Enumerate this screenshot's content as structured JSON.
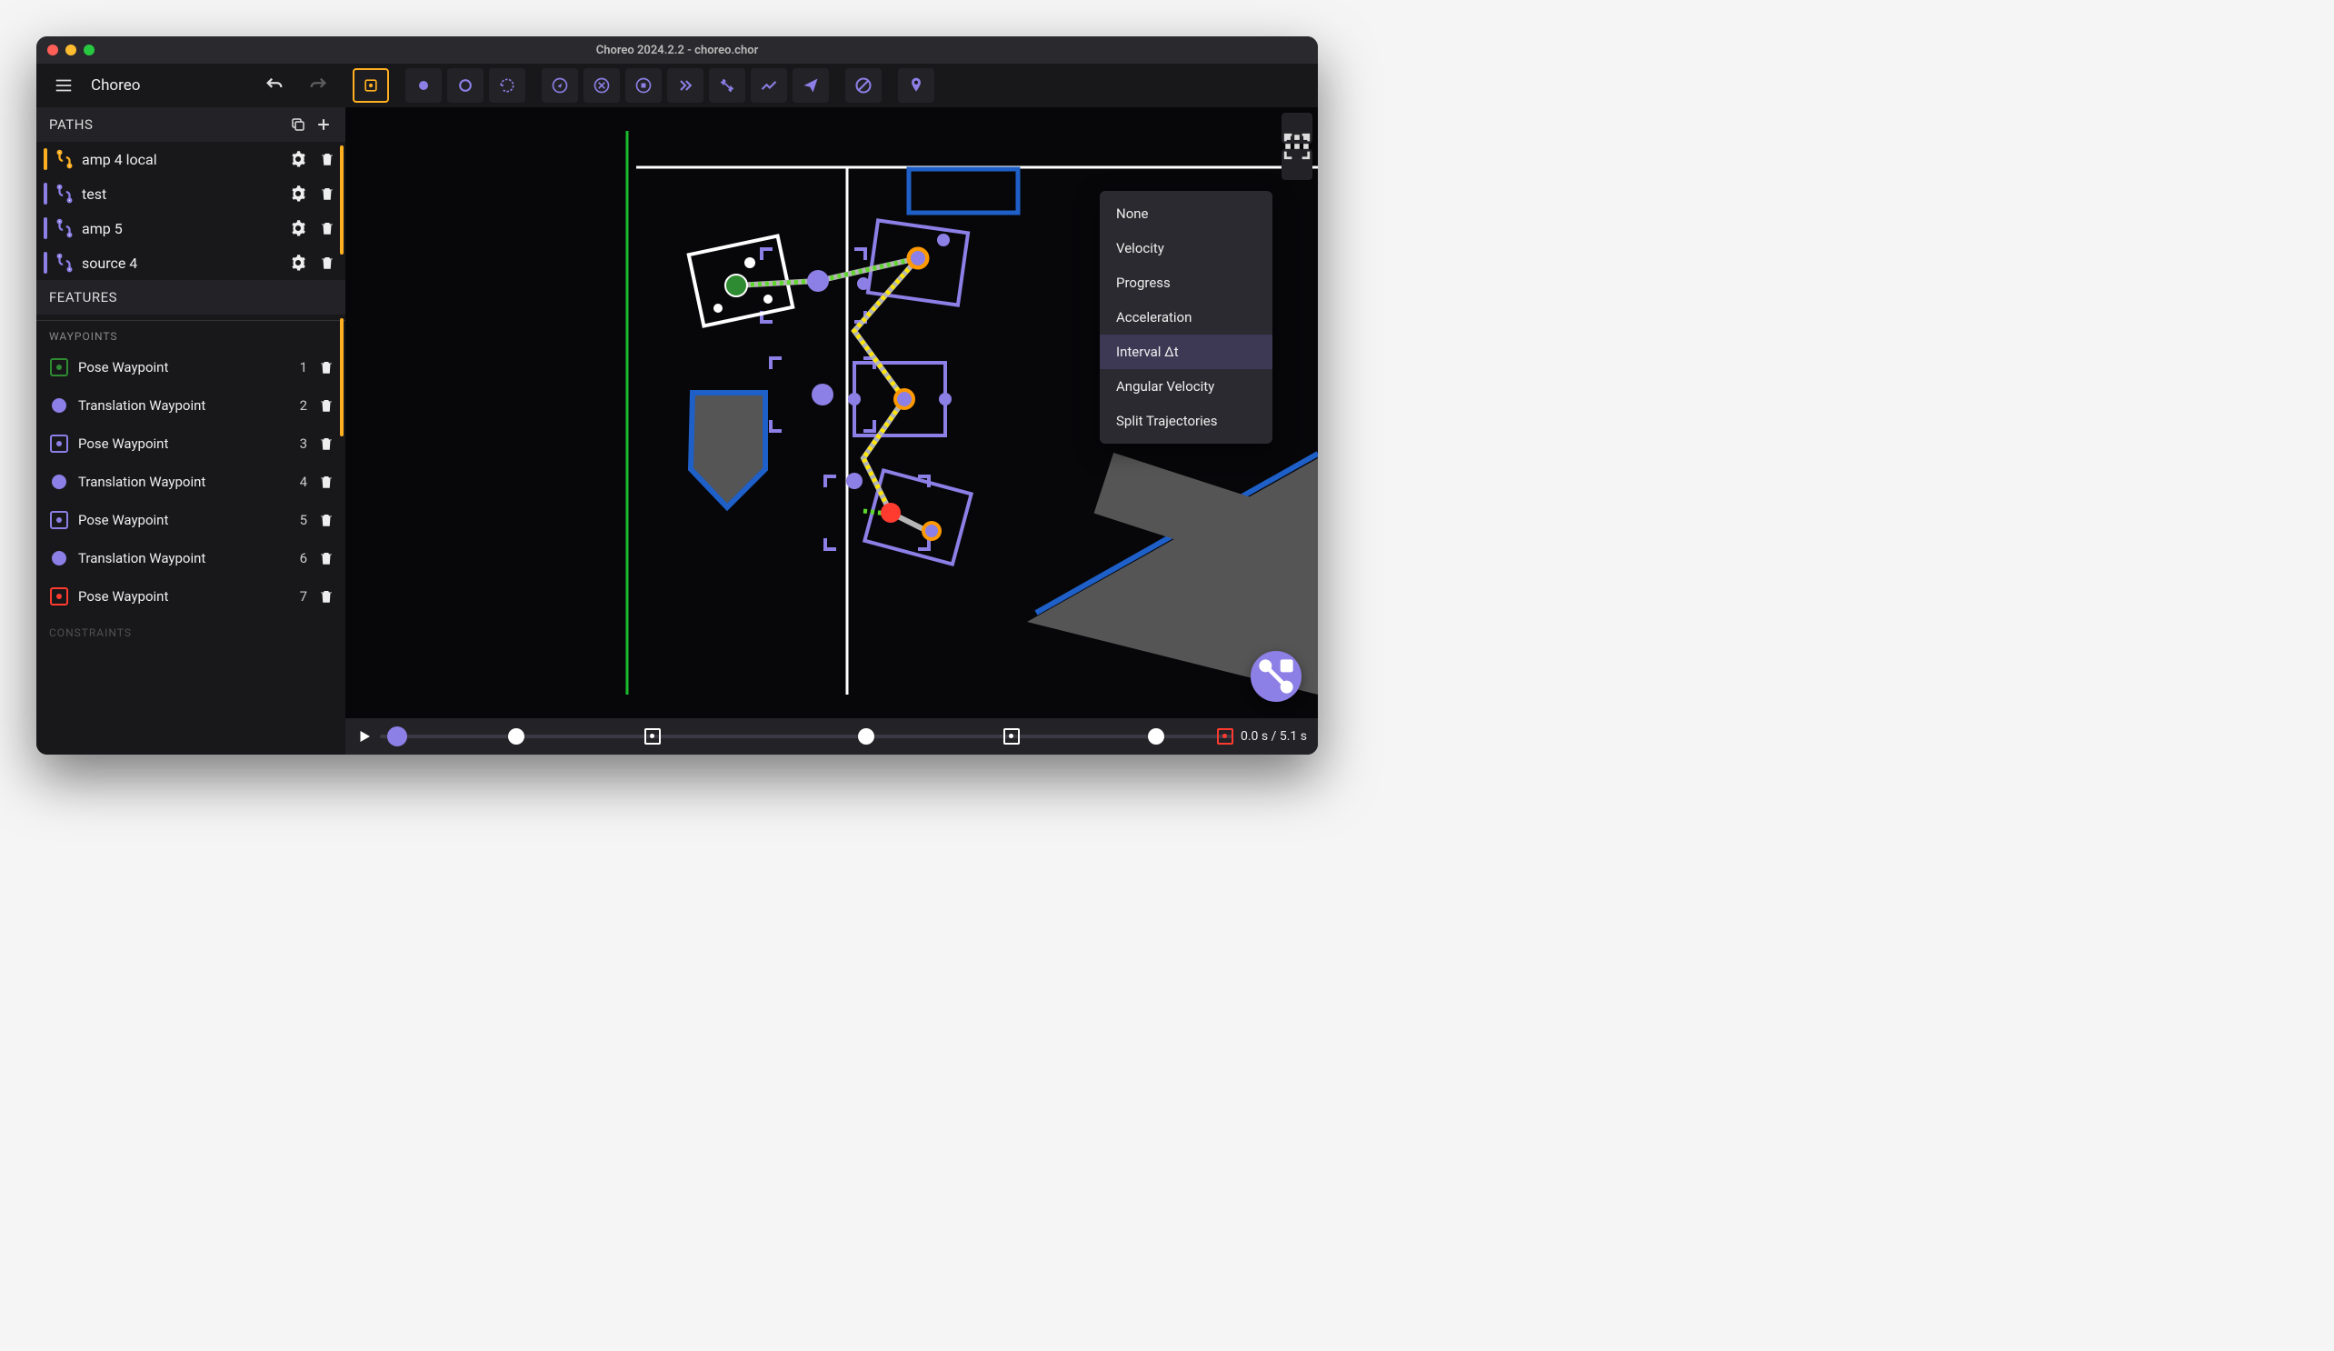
{
  "window": {
    "title": "Choreo 2024.2.2 - choreo.chor"
  },
  "app": {
    "name": "Choreo"
  },
  "sections": {
    "paths": "PATHS",
    "features": "FEATURES",
    "waypoints": "WAYPOINTS",
    "constraints": "CONSTRAINTS"
  },
  "paths": [
    {
      "name": "amp 4 local",
      "active": true
    },
    {
      "name": "test",
      "active": false
    },
    {
      "name": "amp 5",
      "active": false
    },
    {
      "name": "source 4",
      "active": false
    }
  ],
  "waypoints": [
    {
      "label": "Pose Waypoint",
      "index": "1",
      "type": "pose",
      "color": "#2e8b32"
    },
    {
      "label": "Translation Waypoint",
      "index": "2",
      "type": "trans"
    },
    {
      "label": "Pose Waypoint",
      "index": "3",
      "type": "pose",
      "color": "#8c7fe6"
    },
    {
      "label": "Translation Waypoint",
      "index": "4",
      "type": "trans"
    },
    {
      "label": "Pose Waypoint",
      "index": "5",
      "type": "pose",
      "color": "#8c7fe6"
    },
    {
      "label": "Translation Waypoint",
      "index": "6",
      "type": "trans"
    },
    {
      "label": "Pose Waypoint",
      "index": "7",
      "type": "pose",
      "color": "#ff3b30"
    }
  ],
  "popup": {
    "items": [
      "None",
      "Velocity",
      "Progress",
      "Acceleration",
      "Interval Δt",
      "Angular Velocity",
      "Split Trajectories"
    ],
    "selected": 4
  },
  "timeline": {
    "current": "0.0 s",
    "total": "5.1 s",
    "markers": [
      {
        "type": "big",
        "pos": 2
      },
      {
        "type": "circ",
        "pos": 16
      },
      {
        "type": "sq",
        "pos": 32
      },
      {
        "type": "circ",
        "pos": 57
      },
      {
        "type": "sq",
        "pos": 74
      },
      {
        "type": "circ",
        "pos": 91
      },
      {
        "type": "sqr",
        "pos": 99
      }
    ]
  },
  "toolbar_icons": [
    "pose-select",
    "dot",
    "circle",
    "rotate",
    "compass",
    "cancel",
    "target",
    "forward",
    "swap",
    "trend",
    "send",
    "block",
    "pin"
  ],
  "colors": {
    "accent": "#8c7fe6",
    "highlight": "#ffb020"
  }
}
